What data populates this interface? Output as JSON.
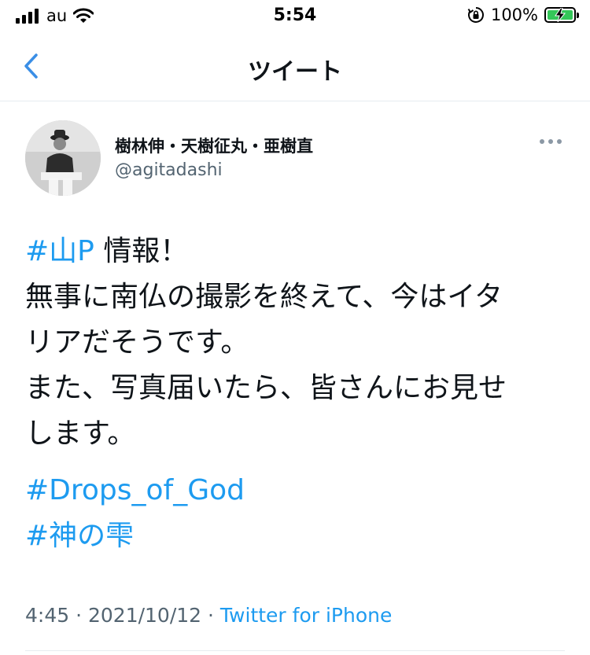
{
  "status_bar": {
    "carrier": "au",
    "time": "5:54",
    "battery_percent": "100%",
    "battery_level": 1.0,
    "charging": true,
    "icons": [
      "signal-icon",
      "wifi-icon",
      "orientation-lock-icon",
      "battery-charging-icon"
    ]
  },
  "nav": {
    "title": "ツイート",
    "back_icon": "chevron-left-icon"
  },
  "tweet": {
    "author": {
      "name": "樹林伸・天樹征丸・亜樹直",
      "handle": "@agitadashi"
    },
    "more_icon": "more-horizontal-icon",
    "lines": {
      "l1_tag": "#山P",
      "l1_text": " 情報！",
      "l2": "無事に南仏の撮影を終えて、今はイタ",
      "l3": "リアだそうです。",
      "l4": "また、写真届いたら、皆さんにお見せ",
      "l5": "します。",
      "tag2": "#Drops_of_God",
      "tag3": "#神の雫"
    },
    "meta": {
      "time": "4:45",
      "separator": " · ",
      "date": "2021/10/12",
      "source": "Twitter for iPhone"
    }
  },
  "colors": {
    "accent": "#1d9bf0",
    "back_chevron": "#3a8ee6",
    "secondary_text": "#536471",
    "battery_fill": "#34c759"
  }
}
